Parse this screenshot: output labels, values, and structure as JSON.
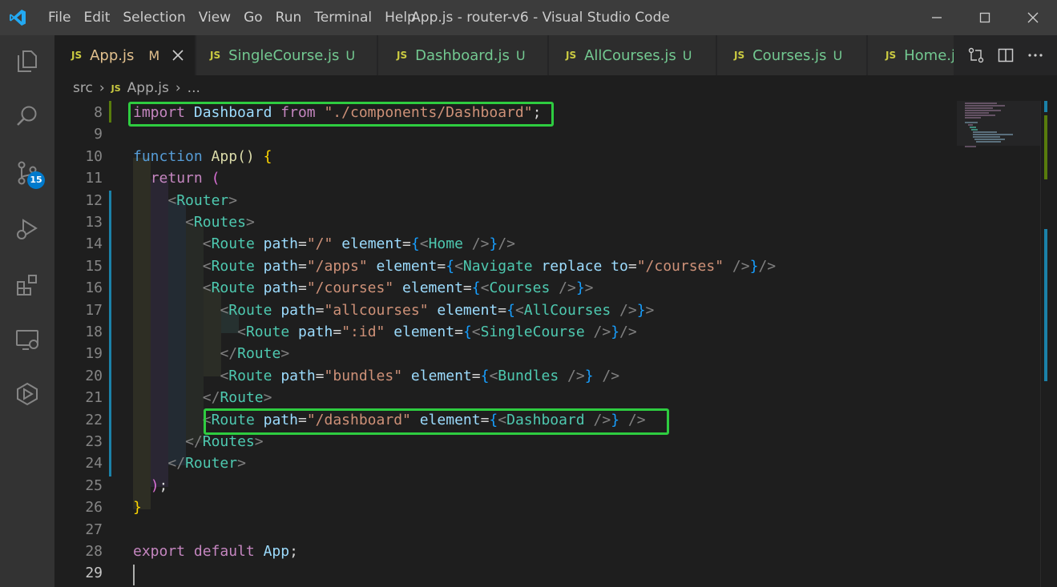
{
  "window": {
    "title": "App.js - router-v6 - Visual Studio Code"
  },
  "menu": [
    "File",
    "Edit",
    "Selection",
    "View",
    "Go",
    "Run",
    "Terminal",
    "Help"
  ],
  "activity_bar": {
    "items": [
      "explorer-icon",
      "search-icon",
      "source-control-icon",
      "run-debug-icon",
      "extensions-icon",
      "remote-explorer-icon",
      "live-share-icon"
    ],
    "source_control_badge": "15"
  },
  "tabs": [
    {
      "icon": "JS",
      "name": "App.js",
      "status": "M",
      "active": true
    },
    {
      "icon": "JS",
      "name": "SingleCourse.js",
      "status": "U",
      "active": false
    },
    {
      "icon": "JS",
      "name": "Dashboard.js",
      "status": "U",
      "active": false
    },
    {
      "icon": "JS",
      "name": "AllCourses.js",
      "status": "U",
      "active": false
    },
    {
      "icon": "JS",
      "name": "Courses.js",
      "status": "U",
      "active": false
    },
    {
      "icon": "JS",
      "name": "Home.j",
      "status": "",
      "active": false
    }
  ],
  "breadcrumb": {
    "folder": "src",
    "icon": "JS",
    "file": "App.js",
    "tail": "..."
  },
  "editor": {
    "line_numbers": [
      "8",
      "9",
      "10",
      "11",
      "12",
      "13",
      "14",
      "15",
      "16",
      "17",
      "18",
      "19",
      "20",
      "21",
      "22",
      "23",
      "24",
      "25",
      "26",
      "27",
      "28",
      "29"
    ],
    "current_line": "29",
    "lines": [
      "import Dashboard from \"./components/Dashboard\";",
      "",
      "function App() {",
      "  return (",
      "    <Router>",
      "      <Routes>",
      "        <Route path=\"/\" element={<Home />}/>",
      "        <Route path=\"/apps\" element={<Navigate replace to=\"/courses\" />}/>",
      "        <Route path=\"/courses\" element={<Courses />}>",
      "          <Route path=\"allcourses\" element={<AllCourses />}>",
      "            <Route path=\":id\" element={<SingleCourse />}/>",
      "          </Route>",
      "          <Route path=\"bundles\" element={<Bundles />} />",
      "        </Route>",
      "        <Route path=\"/dashboard\" element={<Dashboard />} />",
      "      </Routes>",
      "    </Router>",
      "  );",
      "}",
      "",
      "export default App;",
      ""
    ],
    "highlighted_lines": [
      "8",
      "22"
    ]
  },
  "colors": {
    "highlight_box": "#2ecc40",
    "accent": "#007acc"
  }
}
